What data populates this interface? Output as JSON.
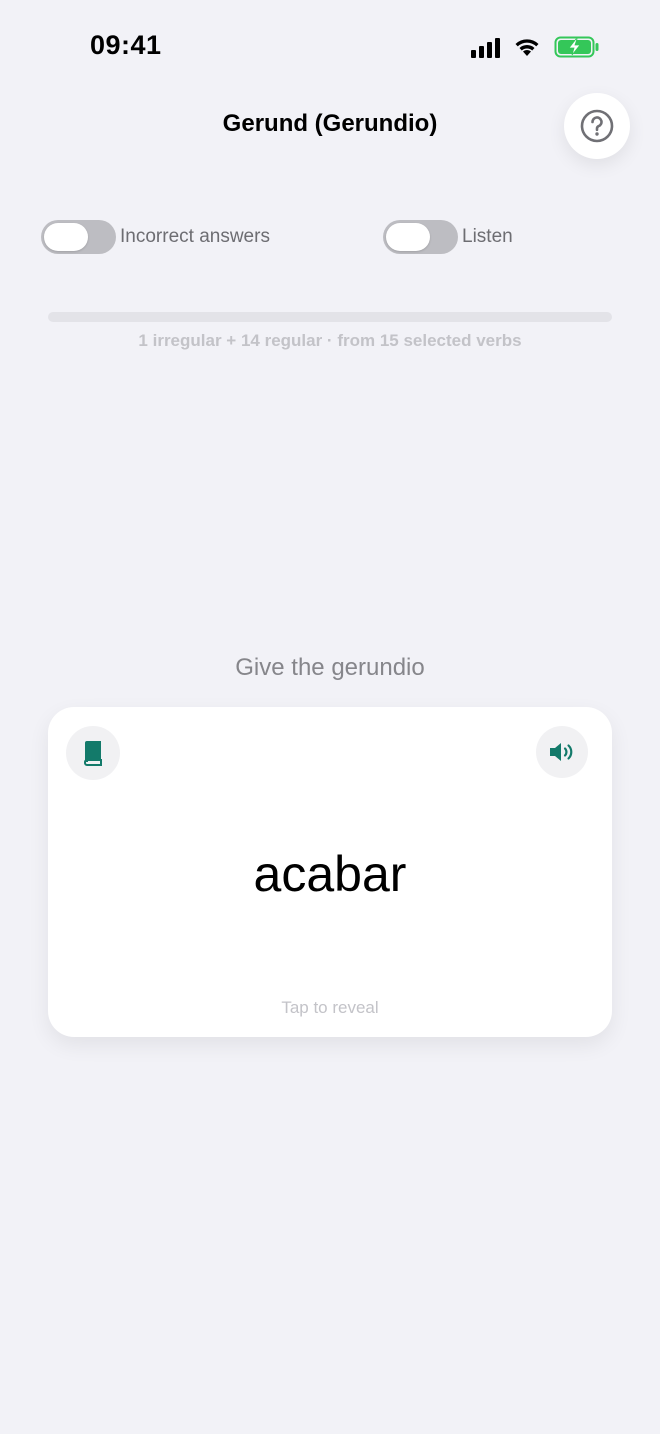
{
  "status_bar": {
    "time": "09:41",
    "battery_color": "#34c759"
  },
  "header": {
    "title": "Gerund (Gerundio)",
    "help_icon": "question-circle-icon"
  },
  "toggles": [
    {
      "label": "Incorrect answers",
      "on": false
    },
    {
      "label": "Listen",
      "on": false
    }
  ],
  "progress": {
    "fraction": 0.0,
    "caption": "1 irregular + 14 regular · from 15 selected verbs"
  },
  "prompt": "Give the gerundio",
  "card": {
    "word": "acabar",
    "hint": "Tap to reveal",
    "left_icon": "book-icon",
    "right_icon": "speaker-icon",
    "accent_color": "#137a6a"
  }
}
